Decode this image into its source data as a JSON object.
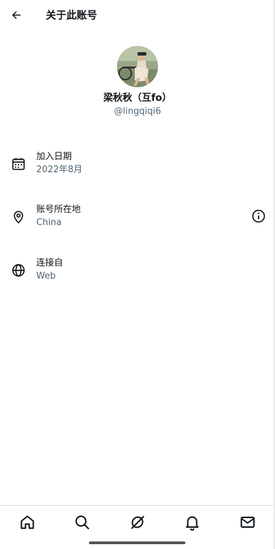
{
  "header": {
    "title": "关于此账号"
  },
  "profile": {
    "display_name": "梁秋秋（互fo）",
    "handle": "@lingqiqi6"
  },
  "info_rows": [
    {
      "icon": "calendar-icon",
      "label": "加入日期",
      "value": "2022年8月"
    },
    {
      "icon": "location-pin-icon",
      "label": "账号所在地",
      "value": "China",
      "has_info_button": true
    },
    {
      "icon": "globe-icon",
      "label": "连接自",
      "value": "Web"
    }
  ],
  "bottom_nav": {
    "items": [
      "home-icon",
      "search-icon",
      "grok-icon",
      "notifications-bell-icon",
      "messages-envelope-icon"
    ]
  }
}
